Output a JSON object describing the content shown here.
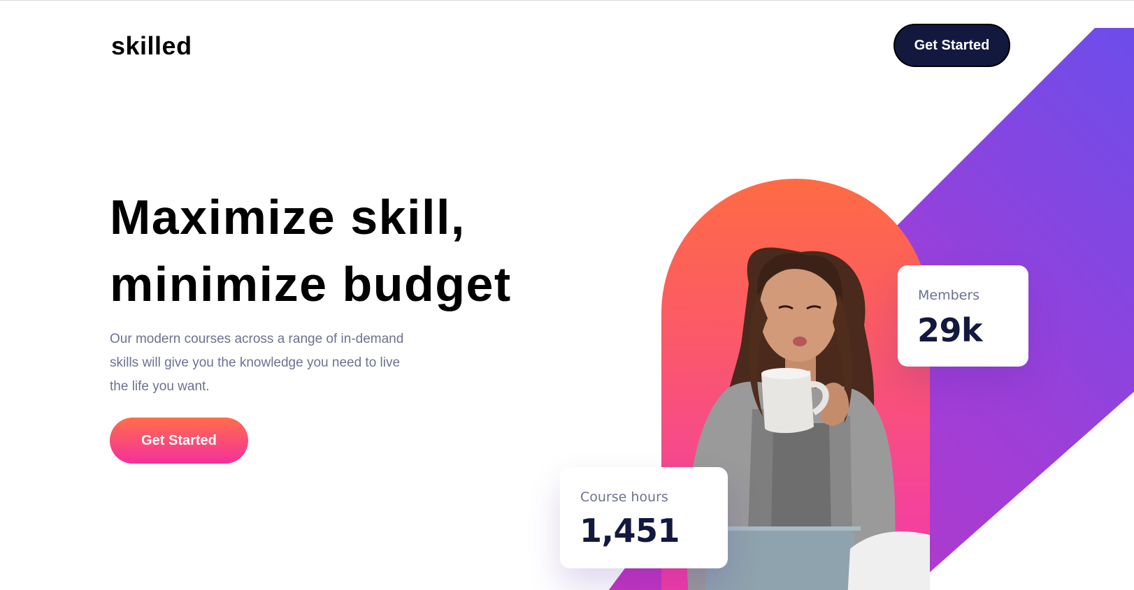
{
  "brand": {
    "logo": "skilled"
  },
  "header": {
    "cta_label": "Get Started"
  },
  "hero": {
    "headline_line1": "Maximize skill,",
    "headline_line2": "minimize budget",
    "description": "Our modern courses across a range of in-demand skills will give you the knowledge you need to live the life you want.",
    "cta_label": "Get Started"
  },
  "stats": {
    "members": {
      "label": "Members",
      "value": "29k"
    },
    "course_hours": {
      "label": "Course hours",
      "value": "1,451"
    }
  },
  "colors": {
    "navy": "#13183f",
    "body_text": "#6c7290",
    "gradient_orange": "#ff6e4a",
    "gradient_pink": "#f52f9d",
    "gradient_purple": "#6c4dea"
  }
}
